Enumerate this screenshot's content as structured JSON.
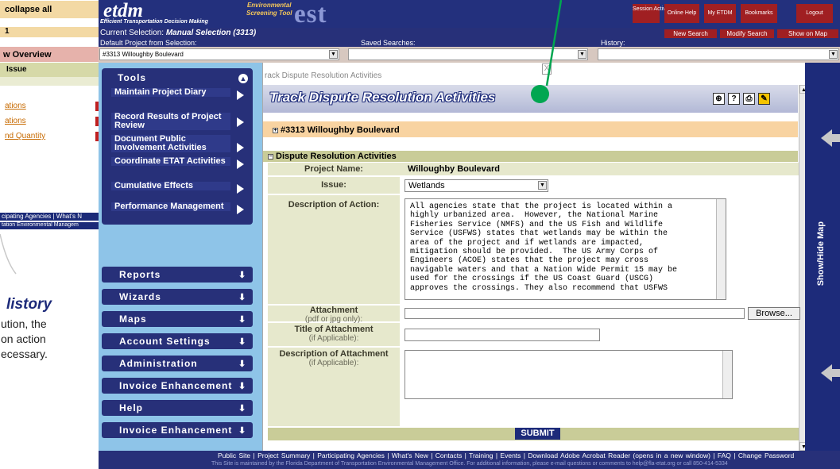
{
  "left_panel": {
    "collapse": "collapse all",
    "number": "1",
    "overview": "w Overview",
    "issue": "Issue",
    "links": [
      "ations",
      "ations",
      "nd Quantity"
    ],
    "bar1": "cipating Agencies  |  What's N",
    "bar2": "tation Environmental Managem",
    "history_title": "listory",
    "body_lines": [
      "ution, the",
      "on action",
      "ecessary."
    ]
  },
  "header": {
    "logo": "etdm",
    "logo_sub": "Efficient Transportation Decision Making",
    "env_line1": "Environmental",
    "env_line2": "Screening Tool",
    "est": "est",
    "buttons": [
      "Session Active",
      "Online Help",
      "My ETDM",
      "Bookmarks",
      "Logout"
    ]
  },
  "selection": {
    "current_label": "Current Selection:",
    "current_value": "Manual Selection (3313)",
    "buttons": [
      "New Search",
      "Modify Search",
      "Show on Map"
    ],
    "default_label": "Default Project from Selection:",
    "saved_label": "Saved Searches:",
    "history_label": "History:",
    "default_value": "#3313 Willoughby Boulevard"
  },
  "menu": {
    "tools_label": "Tools",
    "tools_items": [
      "Maintain Project Diary",
      "Record Results of Project Review",
      "Document Public Involvement Activities",
      "Coordinate ETAT Activities",
      "Cumulative Effects",
      "Performance Management"
    ],
    "buttons": [
      "Reports",
      "Wizards",
      "Maps",
      "Account Settings",
      "Administration",
      "Invoice Enhancement",
      "Help",
      "Invoice Enhancement"
    ]
  },
  "content": {
    "crumb": "rack Dispute Resolution Activities",
    "close": "X",
    "title": "Track Dispute Resolution Activities",
    "project_bar": "#3313 Willoughby Boulevard",
    "section": "Dispute Resolution Activities",
    "project_name_label": "Project Name:",
    "project_name": "Willoughby Boulevard",
    "issue_label": "Issue:",
    "issue_value": "Wetlands",
    "desc_label": "Description of Action:",
    "desc_text": "All agencies state that the project is located within a\nhighly urbanized area.  However, the National Marine\nFisheries Service (NMFS) and the US Fish and Wildlife\nService (USFWS) states that wetlands may be within the\narea of the project and if wetlands are impacted,\nmitigation should be provided.  The US Army Corps of\nEngineers (ACOE) states that the project may cross\nnavigable waters and that a Nation Wide Permit 15 may be\nused for the crossings if the US Coast Guard (USCG)\napproves the crossings. They also recommend that USFWS",
    "attach_label": "Attachment",
    "attach_sub": "(pdf or jpg only):",
    "browse": "Browse...",
    "title_attach_label": "Title of Attachment",
    "title_attach_sub": "(if Applicable):",
    "desc_attach_label": "Description of Attachment",
    "desc_attach_sub": "(if Applicable):",
    "submit": "SUBMIT"
  },
  "right_panel": {
    "show_hide": "Show/Hide Map"
  },
  "footer": {
    "links": "Public Site  |  Project Summary  |  Participating Agencies  |  What's New  |  Contacts  |  Training  |  Events  |  Download Adobe Acrobat Reader (opens in a new window)  |  FAQ  |  Change Password",
    "note": "This Site is maintained by the Florida Department of Transportation Environmental Management Office. For additional information, please e-mail questions or comments to help@fla-etat.org or call 850-414-5334"
  },
  "colors": {
    "navy": "#273079",
    "red_button": "#a01f22",
    "project_bar": "#f8d3a1",
    "green_accent": "#00a651"
  }
}
